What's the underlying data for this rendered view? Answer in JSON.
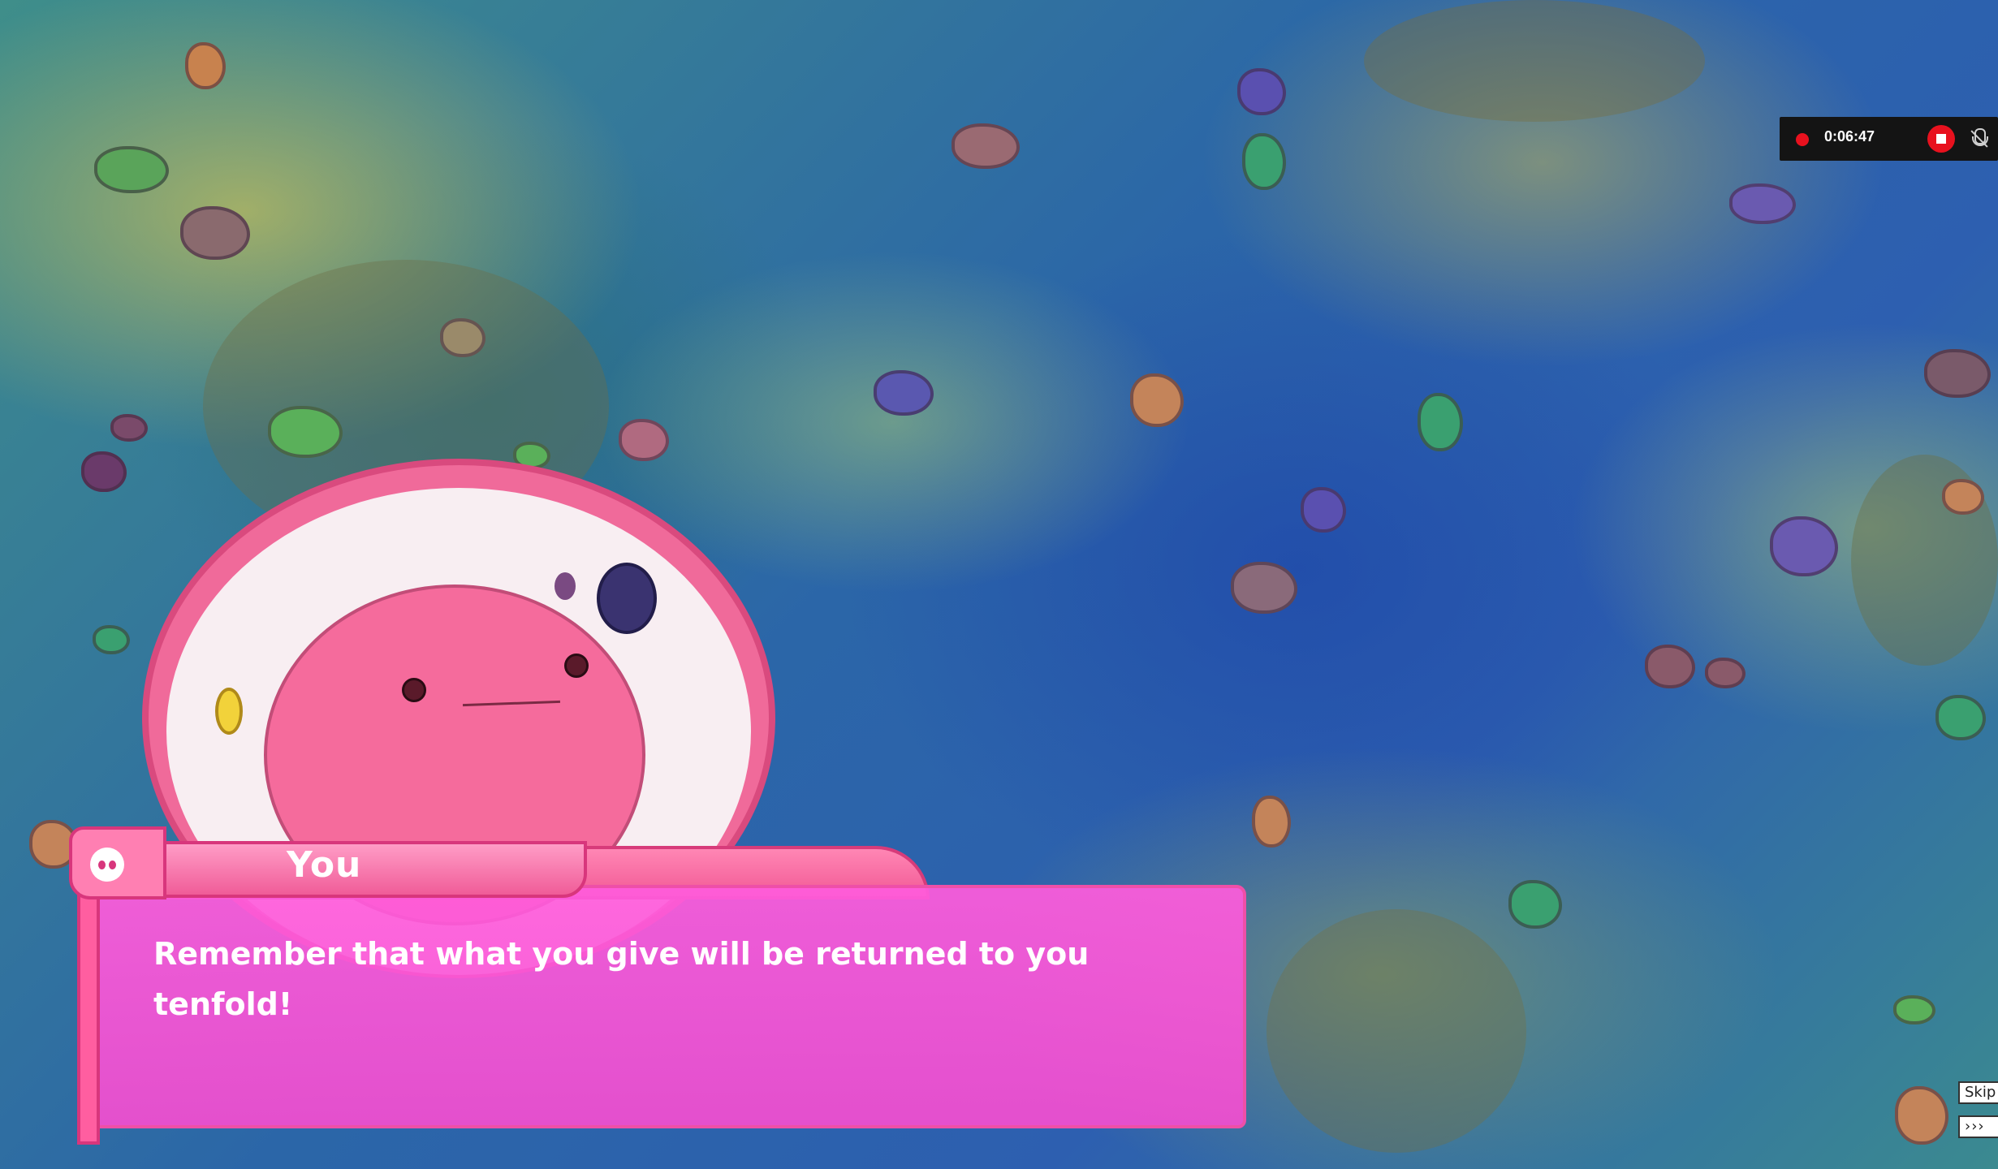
{
  "recording": {
    "time": "0:06:47",
    "stop_icon": "stop-icon",
    "mic_icon": "mic-muted-icon",
    "record_indicator_color": "#e8111e"
  },
  "dialogue": {
    "speaker": "You",
    "text": "Remember that what you give will be returned to you tenfold!",
    "speaker_icon": "face-icon",
    "box_color": "#f550d8",
    "name_color": "#f05c98"
  },
  "controls": {
    "skip_label": "Skip",
    "fast_forward_label": "›››"
  }
}
